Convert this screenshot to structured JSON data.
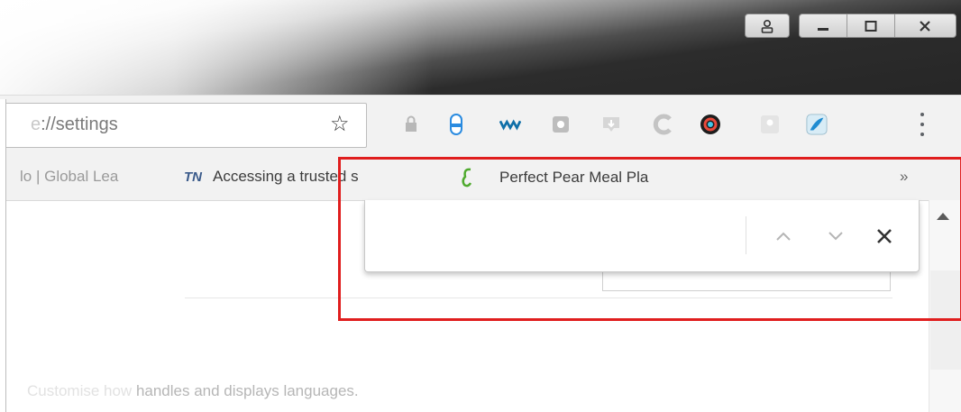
{
  "window": {
    "profile_icon": "person-icon",
    "minimize_icon": "minimize-icon",
    "maximize_icon": "maximize-icon",
    "close_icon": "close-icon"
  },
  "omnibox": {
    "url_faint": "e",
    "url": "://settings",
    "star_icon": "star-icon"
  },
  "extensions": [
    "lock-extension-icon",
    "shield-extension-icon",
    "wave-extension-icon",
    "puzzle-extension-icon",
    "download-extension-icon",
    "c-extension-icon",
    "color-wheel-extension-icon",
    "map-extension-icon",
    "bird-extension-icon"
  ],
  "bookmarks": {
    "items": [
      {
        "label": "lo | Global Lea",
        "icon": ""
      },
      {
        "label": "Accessing a trusted s",
        "icon": "TN"
      },
      {
        "label": "Perfect Pear Meal Pla",
        "icon": "pear-icon"
      }
    ],
    "overflow": "»"
  },
  "findbar": {
    "query": "",
    "prev_icon": "chevron-up-icon",
    "next_icon": "chevron-down-icon",
    "close_icon": "close-icon",
    "close_glyph": "✕"
  },
  "page": {
    "text_ghost": "Customise how ",
    "text": "handles and displays languages."
  },
  "highlight_color": "#e01e1e"
}
